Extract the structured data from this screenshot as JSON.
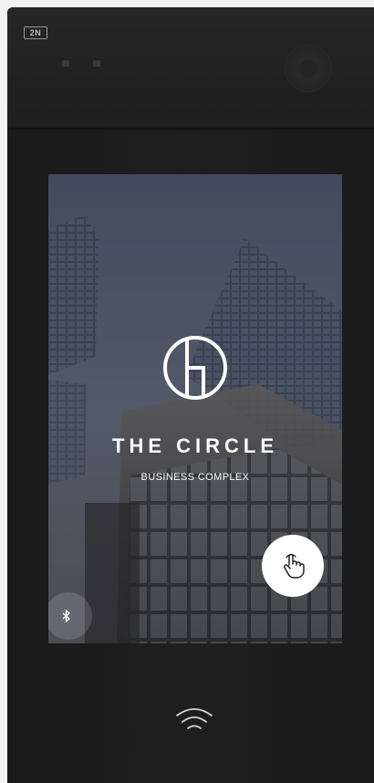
{
  "device": {
    "brand": "2N"
  },
  "screen": {
    "title": "THE CIRCLE",
    "subtitle": "BUSINESS COMPLEX",
    "logo_icon": "circle-h-logo-icon",
    "touch_icon": "hand-tap-icon",
    "bluetooth_icon": "bluetooth-icon"
  },
  "reader": {
    "icon": "nfc-wireless-icon"
  },
  "colors": {
    "device_body": "#1c1c1c",
    "screen_overlay": "#5a6270",
    "accent": "#ffffff"
  }
}
